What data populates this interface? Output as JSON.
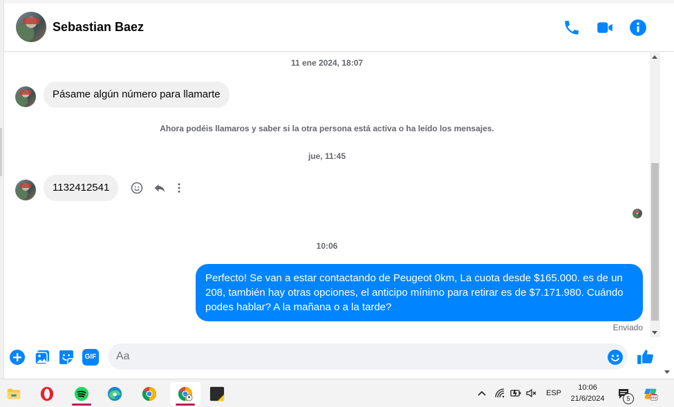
{
  "header": {
    "contact_name": "Sebastian Baez",
    "icons": [
      "phone-icon",
      "video-icon",
      "info-icon"
    ]
  },
  "conversation": {
    "timestamp_1": "11 ene 2024, 18:07",
    "message_1": "Pásame algún número para llamarte",
    "system_note": "Ahora podéis llamaros y saber si la otra persona está activa o ha leído los mensajes.",
    "timestamp_2": "jue, 11:45",
    "message_2": "1132412541",
    "timestamp_3": "10:06",
    "message_3": "Perfecto!  Se van a estar contactando de Peugeot 0km, La cuota desde $165.000. es de un 208, también hay otras opciones, el anticipo mínimo para retirar es de $7.171.980. Cuándo podes hablar? A la mañana o a la tarde?",
    "status": "Enviado"
  },
  "composer": {
    "placeholder": "Aa",
    "icons": [
      "plus-icon",
      "image-icon",
      "sticker-icon",
      "gif-icon",
      "emoji-icon",
      "like-icon"
    ],
    "gif_label": "GIF"
  },
  "taskbar": {
    "apps": [
      "file-explorer",
      "opera",
      "spotify",
      "edge",
      "chrome",
      "chrome-profile",
      "sticky-app"
    ],
    "tray_language": "ESP",
    "time": "10:06",
    "date": "21/6/2024",
    "notification_count": "5"
  },
  "colors": {
    "accent": "#0084ff",
    "incoming_bubble": "#f0f0f0",
    "text_secondary": "#65676b"
  }
}
